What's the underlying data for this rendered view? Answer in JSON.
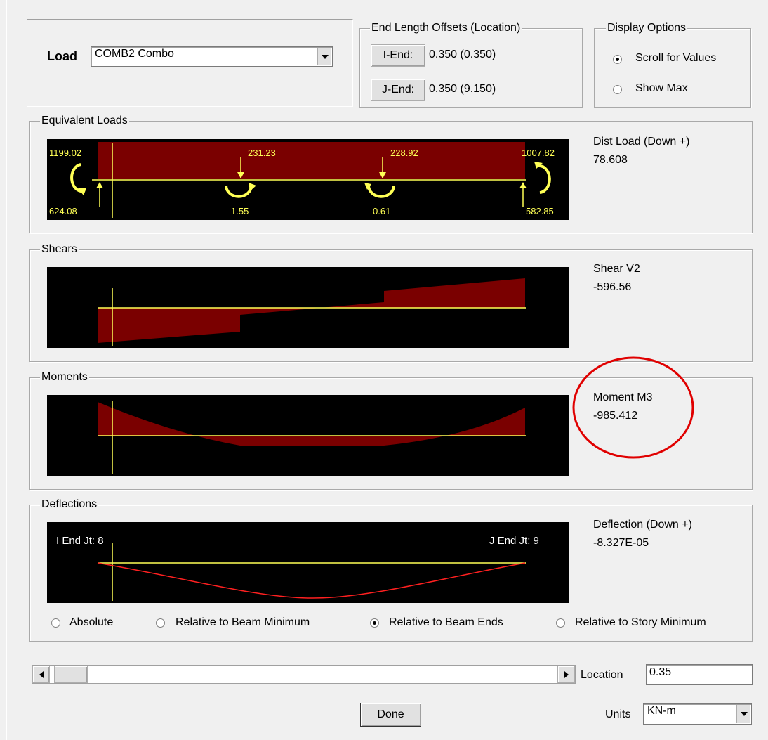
{
  "load": {
    "label": "Load",
    "value": "COMB2 Combo"
  },
  "offsets": {
    "title": "End Length Offsets (Location)",
    "i_end_button": "I-End:",
    "i_end_value": "0.350  (0.350)",
    "j_end_button": "J-End:",
    "j_end_value": "0.350  (9.150)"
  },
  "display": {
    "title": "Display Options",
    "options": [
      "Scroll for Values",
      "Show Max"
    ],
    "selected": "Scroll for Values"
  },
  "equivalent_loads": {
    "title": "Equivalent Loads",
    "value_label": "Dist Load (Down +)",
    "value": "78.608",
    "labels": {
      "left_top": "1199.02",
      "mid1_top": "231.23",
      "mid2_top": "228.92",
      "right_top": "1007.82",
      "left_bottom": "624.08",
      "mid1_bottom": "1.55",
      "mid2_bottom": "0.61",
      "right_bottom": "582.85"
    }
  },
  "shears": {
    "title": "Shears",
    "value_label": "Shear V2",
    "value": "-596.56"
  },
  "moments": {
    "title": "Moments",
    "value_label": "Moment M3",
    "value": "-985.412"
  },
  "deflections": {
    "title": "Deflections",
    "value_label": "Deflection (Down +)",
    "value": "-8.327E-05",
    "i_end_label": "I End Jt: 8",
    "j_end_label": "J End Jt: 9",
    "modes": [
      "Absolute",
      "Relative to Beam Minimum",
      "Relative to Beam Ends",
      "Relative to Story Minimum"
    ],
    "selected_mode": "Relative to Beam Ends"
  },
  "footer": {
    "location_label": "Location",
    "location_value": "0.35",
    "done_label": "Done",
    "units_label": "Units",
    "units_value": "KN-m"
  },
  "colors": {
    "diagram_fill": "#7a0000",
    "axis": "#ffff55",
    "deflection_line": "#ff2020",
    "highlight_circle": "#e00000"
  }
}
